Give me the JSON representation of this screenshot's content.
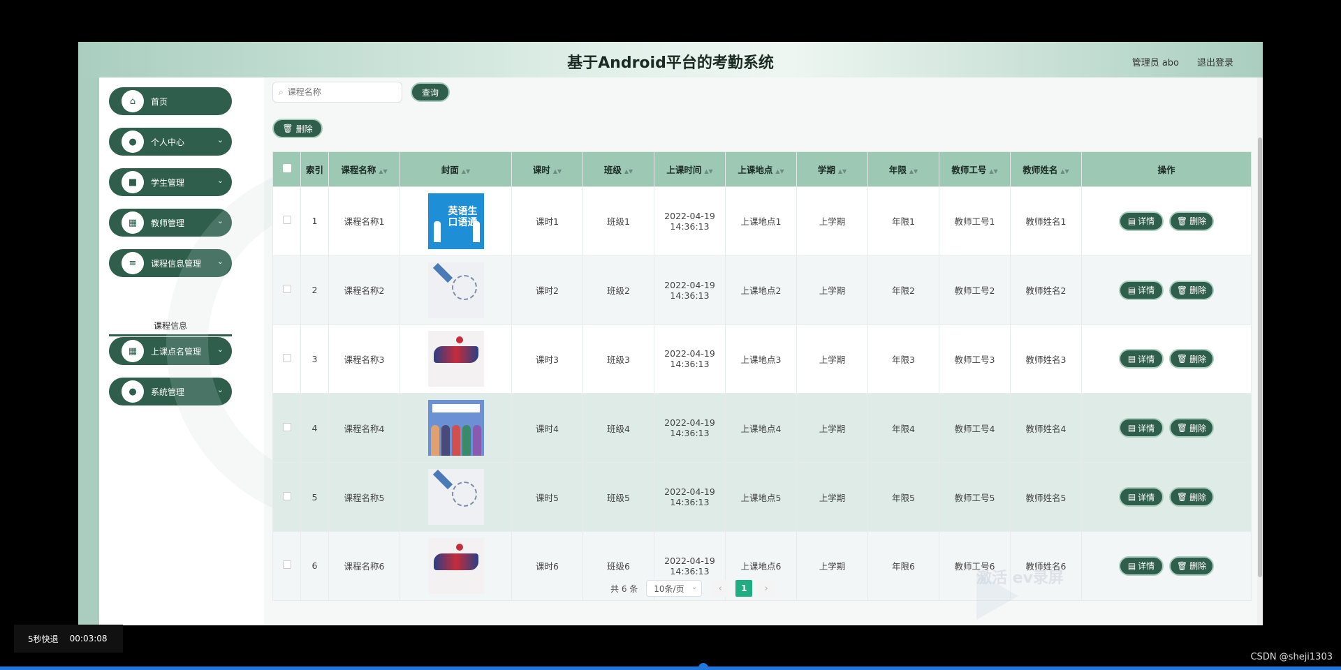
{
  "header": {
    "title": "基于Android平台的考勤系统",
    "user_label": "管理员 abo",
    "logout_label": "退出登录"
  },
  "sidebar": {
    "items": [
      {
        "label": "首页",
        "icon": "home-icon",
        "glyph": "⌂",
        "expandable": false
      },
      {
        "label": "个人中心",
        "icon": "user-icon",
        "glyph": "●",
        "expandable": true
      },
      {
        "label": "学生管理",
        "icon": "briefcase-icon",
        "glyph": "■",
        "expandable": true
      },
      {
        "label": "教师管理",
        "icon": "grid-icon",
        "glyph": "▦",
        "expandable": true
      },
      {
        "label": "课程信息管理",
        "icon": "list-icon",
        "glyph": "≡",
        "expandable": true
      },
      {
        "label": "上课点名管理",
        "icon": "table-icon",
        "glyph": "▦",
        "expandable": true
      },
      {
        "label": "系统管理",
        "icon": "map-pin-icon",
        "glyph": "●",
        "expandable": true
      }
    ],
    "submenu_label": "课程信息",
    "chevron": "⌄"
  },
  "toolbar": {
    "search_placeholder": "课程名称",
    "search_icon": "search-icon",
    "query_label": "查询",
    "delete_label": "删除"
  },
  "table": {
    "headers": [
      "索引",
      "课程名称",
      "封面",
      "课时",
      "班级",
      "上课时间",
      "上课地点",
      "学期",
      "年限",
      "教师工号",
      "教师姓名",
      "操作"
    ],
    "rows": [
      {
        "index": "1",
        "name": "课程名称1",
        "cover": "en",
        "hours": "课时1",
        "class": "班级1",
        "time": "2022-04-19 14:36:13",
        "place": "上课地点1",
        "term": "上学期",
        "years": "年限1",
        "teacher_id": "教师工号1",
        "teacher_name": "教师姓名1"
      },
      {
        "index": "2",
        "name": "课程名称2",
        "cover": "biz",
        "hours": "课时2",
        "class": "班级2",
        "time": "2022-04-19 14:36:13",
        "place": "上课地点2",
        "term": "上学期",
        "years": "年限2",
        "teacher_id": "教师工号2",
        "teacher_name": "教师姓名2"
      },
      {
        "index": "3",
        "name": "课程名称3",
        "cover": "health",
        "hours": "课时3",
        "class": "班级3",
        "time": "2022-04-19 14:36:13",
        "place": "上课地点3",
        "term": "上学期",
        "years": "年限3",
        "teacher_id": "教师工号3",
        "teacher_name": "教师姓名3"
      },
      {
        "index": "4",
        "name": "课程名称4",
        "cover": "hello",
        "hours": "课时4",
        "class": "班级4",
        "time": "2022-04-19 14:36:13",
        "place": "上课地点4",
        "term": "上学期",
        "years": "年限4",
        "teacher_id": "教师工号4",
        "teacher_name": "教师姓名4"
      },
      {
        "index": "5",
        "name": "课程名称5",
        "cover": "biz",
        "hours": "课时5",
        "class": "班级5",
        "time": "2022-04-19 14:36:13",
        "place": "上课地点5",
        "term": "上学期",
        "years": "年限5",
        "teacher_id": "教师工号5",
        "teacher_name": "教师姓名5"
      },
      {
        "index": "6",
        "name": "课程名称6",
        "cover": "health",
        "hours": "课时6",
        "class": "班级6",
        "time": "2022-04-19 14:36:13",
        "place": "上课地点6",
        "term": "上学期",
        "years": "年限6",
        "teacher_id": "教师工号6",
        "teacher_name": "教师姓名6"
      }
    ],
    "cover_texts": {
      "en": "英语生口语通"
    },
    "action_detail": "详情",
    "action_delete": "删除"
  },
  "pagination": {
    "total_label": "共 6 条",
    "page_size_label": "10条/页",
    "current_page": "1",
    "prev": "‹",
    "next": "›"
  },
  "overlay": {
    "speed_label": "5秒快退",
    "time": "00:03:08",
    "watermark": "激活 ev录屏",
    "csdn": "CSDN @sheji1303"
  },
  "colors": {
    "primary": "#2f5e4d",
    "header_bg": "#a9cebf",
    "table_header": "#9cc8b4",
    "pager_active": "#1fae81"
  }
}
